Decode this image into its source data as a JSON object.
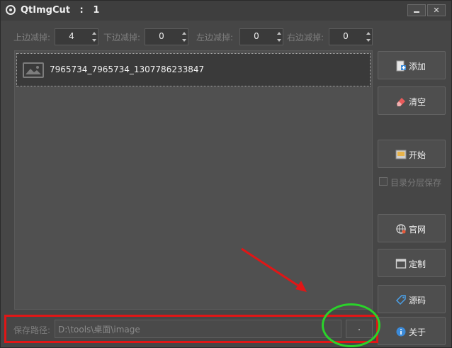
{
  "window": {
    "title": "QtImgCut",
    "title_suffix": ":   1",
    "minimize_label": "",
    "close_label": "✕"
  },
  "margins": [
    {
      "label": "上边减掉:",
      "value": "4"
    },
    {
      "label": "下边减掉:",
      "value": "0"
    },
    {
      "label": "左边减掉:",
      "value": "0"
    },
    {
      "label": "右边减掉:",
      "value": "0"
    }
  ],
  "file_list": {
    "items": [
      {
        "name": "7965734_7965734_1307786233847",
        "icon": "image-thumbnail-icon"
      }
    ]
  },
  "sidebar": {
    "add_label": "添加",
    "clear_label": "清空",
    "start_label": "开始",
    "save_by_dir_label": "目录分层保存",
    "website_label": "官网",
    "custom_label": "定制",
    "source_label": "源码",
    "about_label": "关于"
  },
  "save_path": {
    "label": "保存路径:",
    "value": "D:\\tools\\桌面\\image",
    "browse_label": "."
  },
  "colors": {
    "annotation_red": "#e01616",
    "annotation_green": "#2ad32a"
  }
}
